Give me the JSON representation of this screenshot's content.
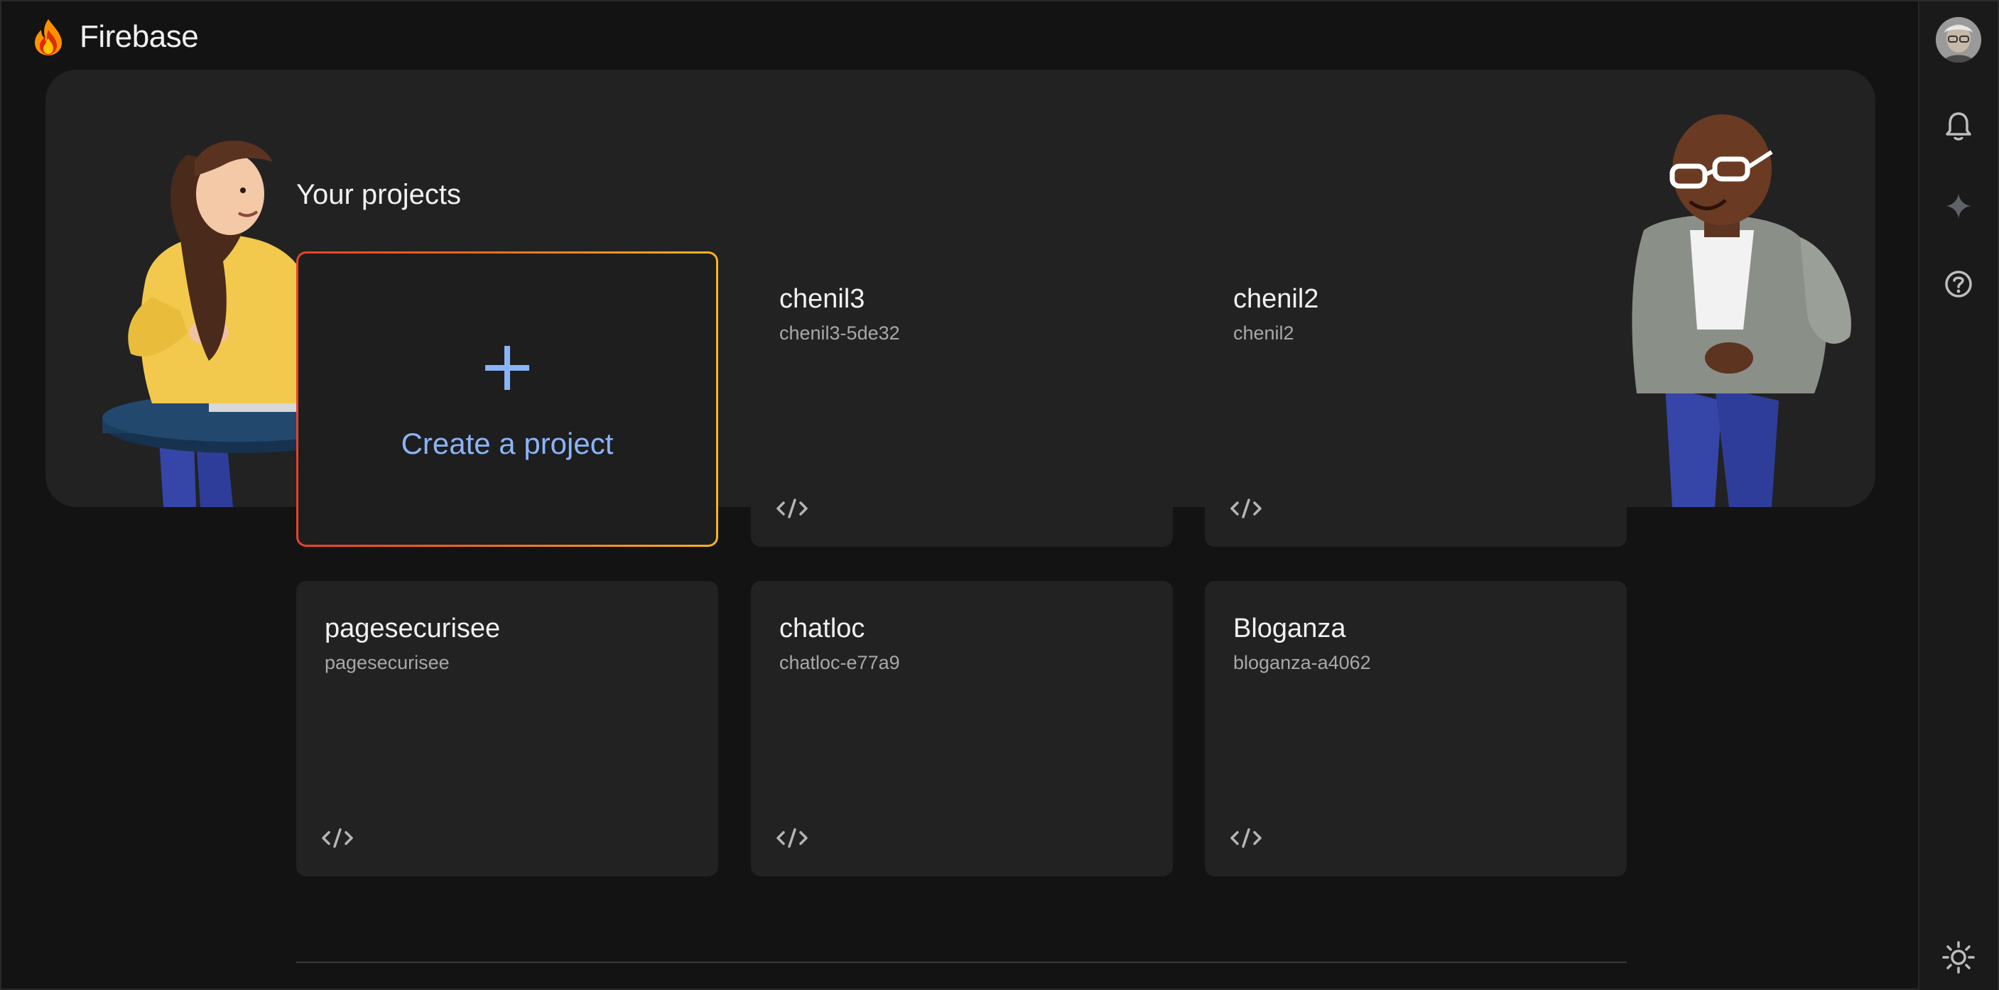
{
  "app": {
    "name": "Firebase"
  },
  "rail": {
    "items": [
      {
        "name": "account",
        "icon": "avatar"
      },
      {
        "name": "notifications",
        "icon": "bell-icon"
      },
      {
        "name": "gemini",
        "icon": "sparkle-icon"
      },
      {
        "name": "help",
        "icon": "help-icon"
      },
      {
        "name": "theme",
        "icon": "sun-icon"
      }
    ]
  },
  "projects": {
    "title": "Your projects",
    "create_label": "Create a project",
    "items": [
      {
        "name": "chenil3",
        "id": "chenil3-5de32",
        "platform_icon": "code-icon"
      },
      {
        "name": "chenil2",
        "id": "chenil2",
        "platform_icon": "code-icon"
      },
      {
        "name": "pagesecurisee",
        "id": "pagesecurisee",
        "platform_icon": "code-icon"
      },
      {
        "name": "chatloc",
        "id": "chatloc-e77a9",
        "platform_icon": "code-icon"
      },
      {
        "name": "Bloganza",
        "id": "bloganza-a4062",
        "platform_icon": "code-icon"
      }
    ]
  },
  "colors": {
    "background": "#131313",
    "surface": "#222222",
    "accent_blue": "#8ab4f8",
    "create_border_start": "#e8412a",
    "create_border_end": "#f7b425"
  }
}
